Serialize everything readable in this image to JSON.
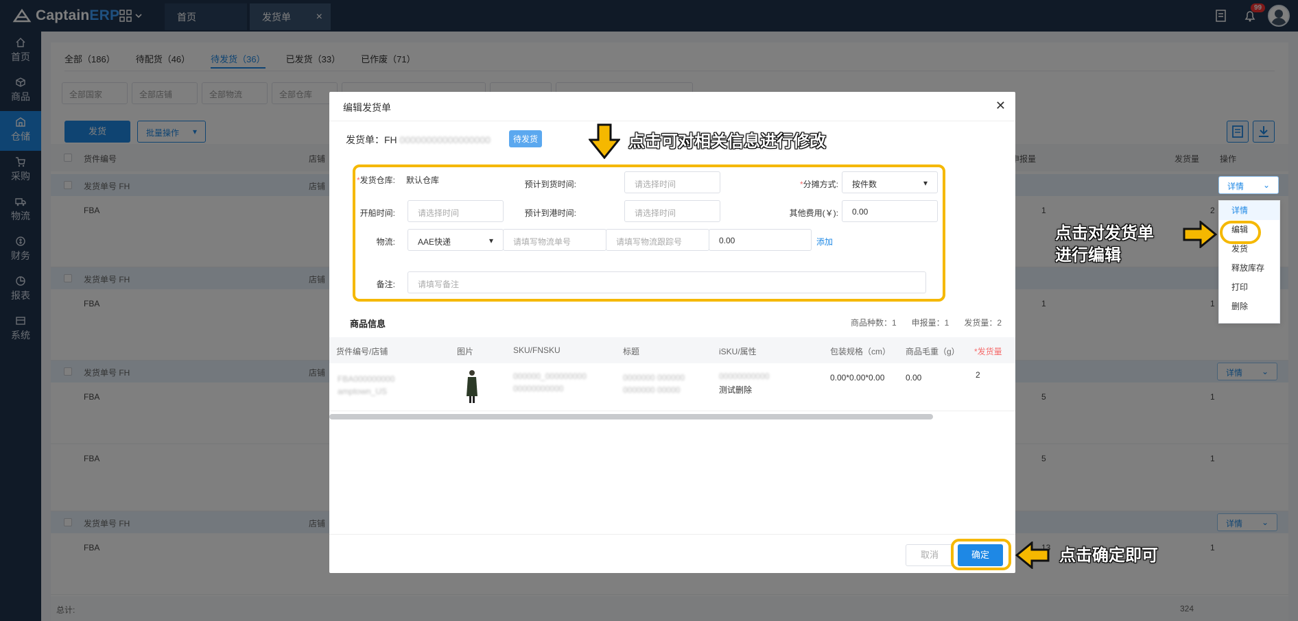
{
  "app": {
    "brand_a": "Captain",
    "brand_b": "ERP",
    "tabs": [
      "首页",
      "发货单"
    ],
    "notification_count": "99"
  },
  "sidebar": {
    "items": [
      {
        "label": "首页",
        "icon": "home-icon"
      },
      {
        "label": "商品",
        "icon": "cube-icon"
      },
      {
        "label": "仓储",
        "icon": "warehouse-icon",
        "active": true
      },
      {
        "label": "采购",
        "icon": "cart-icon"
      },
      {
        "label": "物流",
        "icon": "truck-icon"
      },
      {
        "label": "财务",
        "icon": "finance-icon"
      },
      {
        "label": "报表",
        "icon": "chart-icon"
      },
      {
        "label": "系统",
        "icon": "settings-icon"
      }
    ]
  },
  "subtabs": [
    "全部（186）",
    "待配货（46）",
    "待发货（36）",
    "已发货（33）",
    "已作废（71）"
  ],
  "filters": [
    "全部国家",
    "全部店铺",
    "全部物流",
    "全部仓库"
  ],
  "buttons": {
    "ship": "发货",
    "batch": "批量操作"
  },
  "table": {
    "headers": [
      "货件编号",
      "店铺",
      "申报量",
      "发货量",
      "操作"
    ],
    "group_label": "发货单号 FH",
    "shop_label": "店铺",
    "row_prefix": "FBA",
    "rows": [
      {
        "declared": "1",
        "shipped": "2"
      },
      {
        "declared": "1",
        "shipped": "1"
      },
      {
        "declared": "5",
        "shipped": "1"
      },
      {
        "declared": "5",
        "shipped": "1"
      },
      {
        "declared": "13",
        "shipped": "1"
      }
    ],
    "detail": "详情",
    "total_label": "总计:",
    "total_value": "324"
  },
  "menu": [
    "详情",
    "编辑",
    "发货",
    "释放库存",
    "打印",
    "删除"
  ],
  "modal": {
    "title": "编辑发货单",
    "fh_label": "发货单：FH",
    "status_tag": "待发货",
    "warehouse_label": "发货仓库:",
    "warehouse_value": "默认仓库",
    "eta_ship_label": "预计到货时间:",
    "eta_port_label": "预计到港时间:",
    "ship_time_label": "开船时间:",
    "time_placeholder": "请选择时间",
    "split_label": "分摊方式:",
    "split_value": "按件数",
    "other_fee_label": "其他费用(￥):",
    "other_fee_value": "0.00",
    "logistics_label": "物流:",
    "logistics_value": "AAE快递",
    "logistics_no_placeholder": "请填写物流单号",
    "tracking_placeholder": "请填写物流跟踪号",
    "logistics_fee": "0.00",
    "add_link": "添加",
    "note_label": "备注:",
    "note_placeholder": "请填写备注",
    "section_title": "商品信息",
    "stats": [
      "商品种数：1",
      "申报量：1",
      "发货量：2"
    ],
    "grid_headers": [
      "货件编号/店铺",
      "图片",
      "SKU/FNSKU",
      "标题",
      "iSKU/属性",
      "包装规格（cm）",
      "商品毛重（g）",
      "*发货量"
    ],
    "grid_row": {
      "attr_note": "测试删除",
      "size": "0.00*0.00*0.00",
      "weight": "0.00",
      "qty": "2"
    },
    "cancel": "取消",
    "ok": "确定"
  },
  "annotations": {
    "top": "点击可对相关信息进行修改",
    "edit_1": "点击对发货单",
    "edit_2": "进行编辑",
    "ok": "点击确定即可"
  },
  "colors": {
    "topbar": "#20344e",
    "accent": "#1e88e5",
    "highlight": "#f5b800"
  }
}
